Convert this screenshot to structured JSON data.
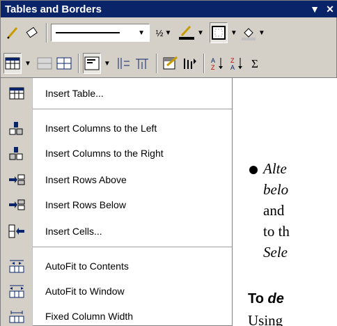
{
  "toolbar": {
    "title": "Tables and Borders",
    "title_controls": [
      "▼",
      "✕"
    ],
    "line_weight": "½"
  },
  "menu": {
    "items": [
      {
        "label": "Insert Table...",
        "icon": "insert-table-icon"
      },
      {
        "label": "Insert Columns to the Left",
        "icon": "insert-columns-left-icon"
      },
      {
        "label": "Insert Columns to the Right",
        "icon": "insert-columns-right-icon"
      },
      {
        "label": "Insert Rows Above",
        "icon": "insert-rows-above-icon"
      },
      {
        "label": "Insert Rows Below",
        "icon": "insert-rows-below-icon"
      },
      {
        "label": "Insert Cells...",
        "icon": "insert-cells-icon"
      },
      {
        "label": "AutoFit to Contents",
        "icon": "autofit-contents-icon"
      },
      {
        "label": "AutoFit to Window",
        "icon": "autofit-window-icon"
      },
      {
        "label": "Fixed Column Width",
        "icon": "fixed-column-width-icon"
      }
    ]
  },
  "document": {
    "lines": [
      "Alte",
      "belo",
      "and",
      "to th",
      "Sele"
    ],
    "heading_prefix": "To ",
    "heading_emphasis": "de",
    "body_start": "Using"
  },
  "colors": {
    "titlebar": "#0a246a",
    "toolbar_bg": "#d4d0c8",
    "menu_gutter": "#d4d0c8"
  }
}
